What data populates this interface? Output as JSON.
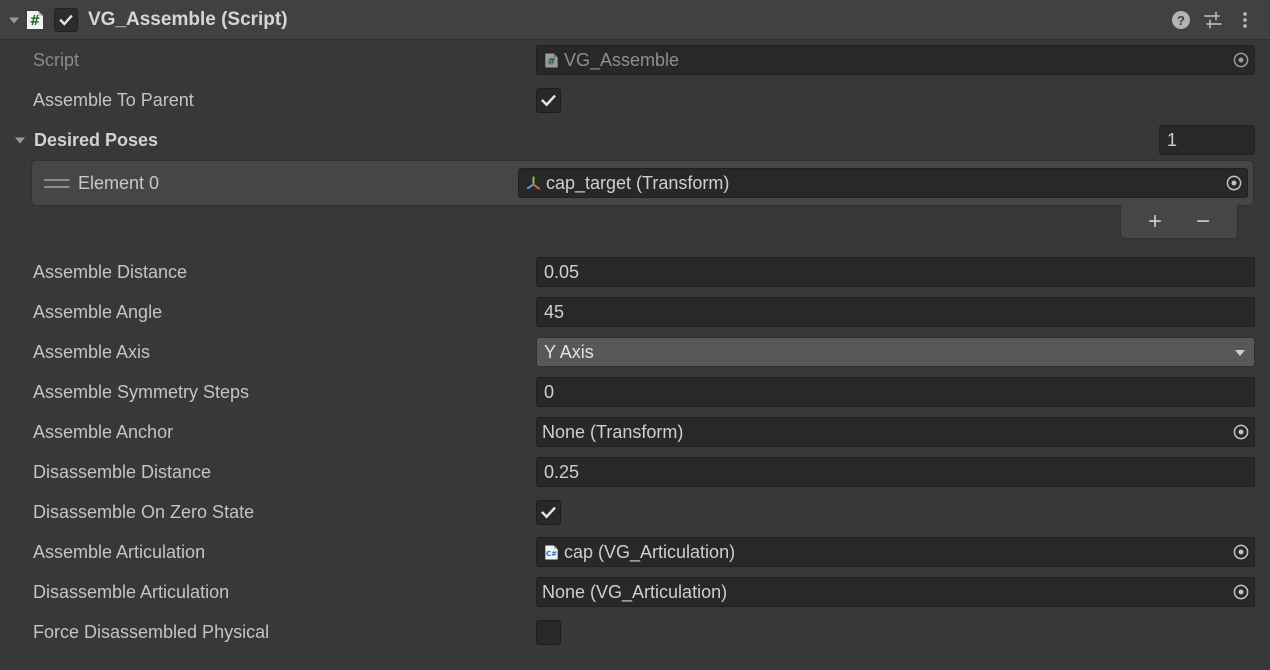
{
  "header": {
    "title": "VG_Assemble (Script)",
    "foldout_expanded": true,
    "enabled": true,
    "script_icon": "csharp-script-icon",
    "help_icon": "help-icon",
    "preset_icon": "preset-sliders-icon",
    "menu_icon": "more-options-icon"
  },
  "colors": {
    "background": "#383838",
    "header_background": "#414141",
    "field_background": "#282828",
    "dropdown_background": "#585858",
    "list_row_background": "#464646",
    "label_text": "#c4c4c4",
    "disabled_text": "#8a8a8a"
  },
  "fields": {
    "script": {
      "label": "Script",
      "value": "VG_Assemble",
      "icon": "csharp-script-icon",
      "disabled": true
    },
    "assemble_to_parent": {
      "label": "Assemble To Parent",
      "checked": true
    },
    "desired_poses": {
      "label": "Desired Poses",
      "size": "1",
      "expanded": true,
      "elements": [
        {
          "label": "Element 0",
          "value": "cap_target (Transform)",
          "icon": "transform-gizmo-icon"
        }
      ],
      "add_label": "+",
      "remove_label": "−"
    },
    "assemble_distance": {
      "label": "Assemble Distance",
      "value": "0.05"
    },
    "assemble_angle": {
      "label": "Assemble Angle",
      "value": "45"
    },
    "assemble_axis": {
      "label": "Assemble Axis",
      "value": "Y Axis"
    },
    "assemble_symmetry_steps": {
      "label": "Assemble Symmetry Steps",
      "value": "0"
    },
    "assemble_anchor": {
      "label": "Assemble Anchor",
      "value": "None (Transform)"
    },
    "disassemble_distance": {
      "label": "Disassemble Distance",
      "value": "0.25"
    },
    "disassemble_on_zero_state": {
      "label": "Disassemble On Zero State",
      "checked": true
    },
    "assemble_articulation": {
      "label": "Assemble Articulation",
      "value": "cap (VG_Articulation)",
      "icon": "csharp-script-icon-blue"
    },
    "disassemble_articulation": {
      "label": "Disassemble Articulation",
      "value": "None (VG_Articulation)"
    },
    "force_disassembled_physical": {
      "label": "Force Disassembled Physical",
      "checked": false
    }
  }
}
